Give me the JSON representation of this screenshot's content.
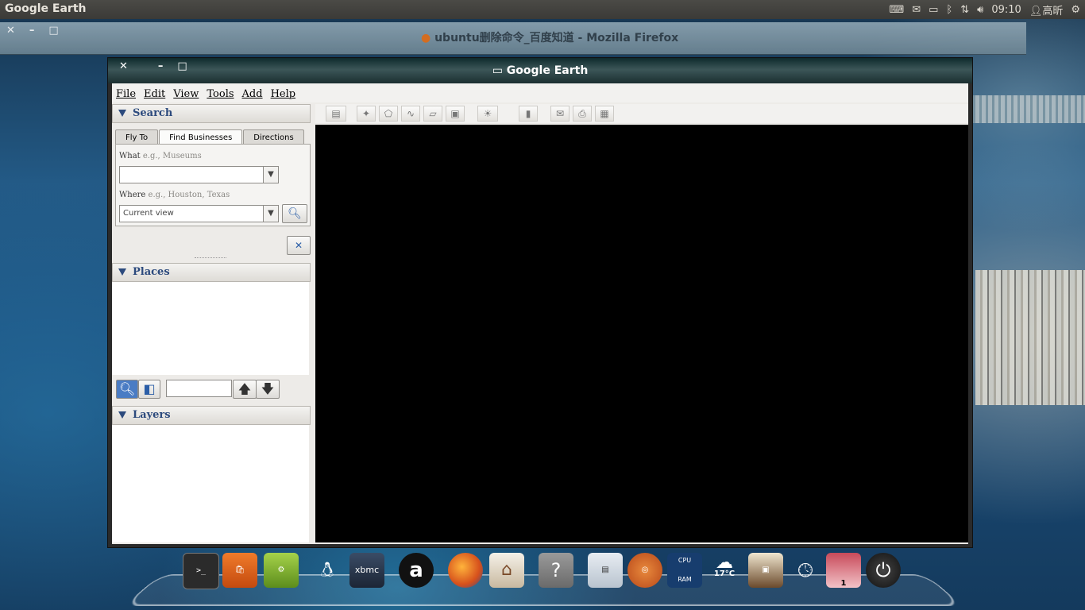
{
  "topbar": {
    "app_name": "Google Earth",
    "clock": "09:10",
    "user": "高昕"
  },
  "firefox_window": {
    "title": "ubuntu删除命令_百度知道 - Mozilla Firefox"
  },
  "ge_window": {
    "title": "Google Earth",
    "menu": [
      "File",
      "Edit",
      "View",
      "Tools",
      "Add",
      "Help"
    ],
    "search_panel": {
      "header": "Search",
      "tabs": [
        "Fly To",
        "Find Businesses",
        "Directions"
      ],
      "active_tab": "Find Businesses",
      "what_label": "What",
      "what_hint": " e.g., Museums",
      "what_value": "",
      "where_label": "Where",
      "where_hint": " e.g., Houston, Texas",
      "where_value": "Current view"
    },
    "places_panel": {
      "header": "Places"
    },
    "layers_panel": {
      "header": "Layers"
    }
  },
  "dock": {
    "items": [
      "Terminal",
      "Ubuntu Software Center",
      "Ubuntu One",
      "Pidgin",
      "XBMC",
      "Amazon",
      "Firefox",
      "Home Folder",
      "Help",
      "System Monitor",
      "Ubuntu",
      "CPU/RAM Monitor",
      "Weather",
      "Slideshow",
      "Clock Search",
      "Workspaces",
      "Shutdown"
    ],
    "weather_temp": "17°C",
    "workspace_number": "1",
    "cpu_label": "CPU",
    "ram_label": "RAM"
  }
}
